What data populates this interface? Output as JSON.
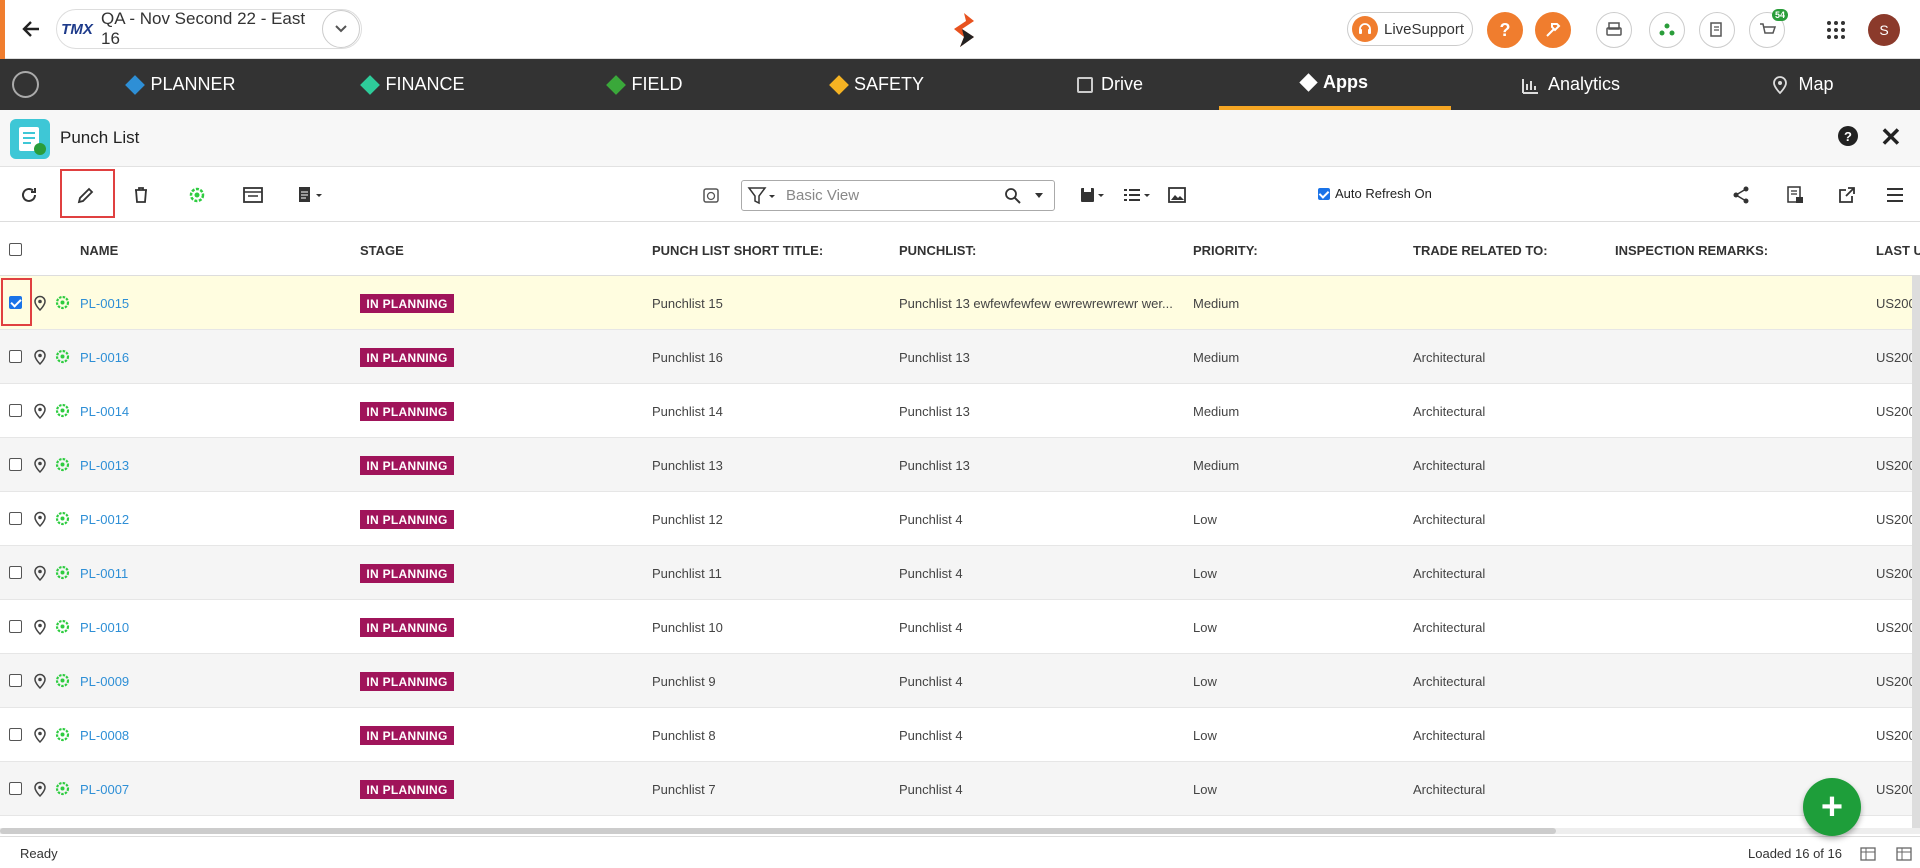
{
  "header": {
    "project_logo": "TMX",
    "project_name": "QA - Nov Second 22 - East 16",
    "live_support": "LiveSupport",
    "help_label": "?",
    "notification_count": "54",
    "avatar_letter": "S"
  },
  "nav": {
    "items": [
      {
        "label": "PLANNER",
        "icon": "planner-icon",
        "color": "#2e8fd6"
      },
      {
        "label": "FINANCE",
        "icon": "finance-icon",
        "color": "#2ecc9a"
      },
      {
        "label": "FIELD",
        "icon": "field-icon",
        "color": "#3aa83a"
      },
      {
        "label": "SAFETY",
        "icon": "safety-icon",
        "color": "#f5b323"
      },
      {
        "label": "Drive",
        "icon": "drive-icon"
      },
      {
        "label": "Apps",
        "icon": "apps-icon",
        "active": true
      },
      {
        "label": "Analytics",
        "icon": "analytics-icon"
      },
      {
        "label": "Map",
        "icon": "map-icon"
      }
    ]
  },
  "page": {
    "title": "Punch List",
    "help": "?",
    "close": "✕"
  },
  "toolbar": {
    "search_placeholder": "Basic View",
    "auto_refresh": "Auto Refresh On"
  },
  "table": {
    "columns": [
      "NAME",
      "STAGE",
      "PUNCH LIST SHORT TITLE:",
      "PUNCHLIST:",
      "PRIORITY:",
      "TRADE RELATED TO:",
      "INSPECTION REMARKS:",
      "LAST U"
    ],
    "rows": [
      {
        "name": "PL-0015",
        "stage": "IN PLANNING",
        "short_title": "Punchlist 15",
        "punchlist": "Punchlist 13 ewfewfewfew ewrewrewrewr wer...",
        "priority": "Medium",
        "trade": "",
        "remarks": "",
        "last": "US200",
        "selected": true
      },
      {
        "name": "PL-0016",
        "stage": "IN PLANNING",
        "short_title": "Punchlist 16",
        "punchlist": "Punchlist 13",
        "priority": "Medium",
        "trade": "Architectural",
        "remarks": "",
        "last": "US200"
      },
      {
        "name": "PL-0014",
        "stage": "IN PLANNING",
        "short_title": "Punchlist 14",
        "punchlist": "Punchlist 13",
        "priority": "Medium",
        "trade": "Architectural",
        "remarks": "",
        "last": "US200"
      },
      {
        "name": "PL-0013",
        "stage": "IN PLANNING",
        "short_title": "Punchlist 13",
        "punchlist": "Punchlist 13",
        "priority": "Medium",
        "trade": "Architectural",
        "remarks": "",
        "last": "US200"
      },
      {
        "name": "PL-0012",
        "stage": "IN PLANNING",
        "short_title": "Punchlist 12",
        "punchlist": "Punchlist 4",
        "priority": "Low",
        "trade": "Architectural",
        "remarks": "",
        "last": "US200"
      },
      {
        "name": "PL-0011",
        "stage": "IN PLANNING",
        "short_title": "Punchlist 11",
        "punchlist": "Punchlist 4",
        "priority": "Low",
        "trade": "Architectural",
        "remarks": "",
        "last": "US200"
      },
      {
        "name": "PL-0010",
        "stage": "IN PLANNING",
        "short_title": "Punchlist 10",
        "punchlist": "Punchlist 4",
        "priority": "Low",
        "trade": "Architectural",
        "remarks": "",
        "last": "US200"
      },
      {
        "name": "PL-0009",
        "stage": "IN PLANNING",
        "short_title": "Punchlist 9",
        "punchlist": "Punchlist 4",
        "priority": "Low",
        "trade": "Architectural",
        "remarks": "",
        "last": "US200"
      },
      {
        "name": "PL-0008",
        "stage": "IN PLANNING",
        "short_title": "Punchlist 8",
        "punchlist": "Punchlist 4",
        "priority": "Low",
        "trade": "Architectural",
        "remarks": "",
        "last": "US200"
      },
      {
        "name": "PL-0007",
        "stage": "IN PLANNING",
        "short_title": "Punchlist 7",
        "punchlist": "Punchlist 4",
        "priority": "Low",
        "trade": "Architectural",
        "remarks": "",
        "last": "US200"
      }
    ]
  },
  "status": {
    "left": "Ready",
    "right": "Loaded 16 of 16"
  },
  "fab": "+"
}
